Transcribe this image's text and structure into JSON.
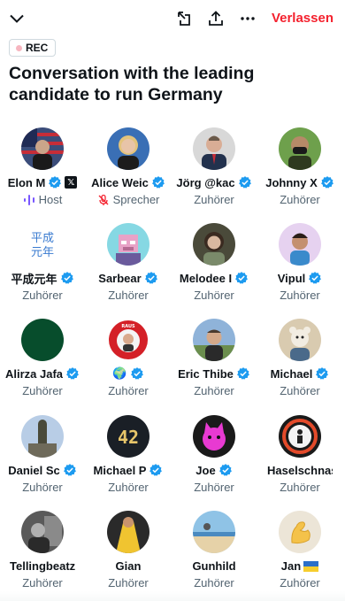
{
  "header": {
    "leave_label": "Verlassen",
    "icons": [
      "chevron-down-icon",
      "minimize-icon",
      "share-icon",
      "more-icon"
    ]
  },
  "rec_badge": "REC",
  "title": "Conversation with the leading candidate to run Germany",
  "accent": "#1d9bf0",
  "leave_color": "#f4212e",
  "participants": [
    {
      "name": "Elon M",
      "role": "Host",
      "verified": true,
      "avatar": "photo-man-flag"
    },
    {
      "name": "Alice Weic",
      "role": "Sprecher",
      "verified": true,
      "avatar": "photo-woman-blonde"
    },
    {
      "name": "Jörg @kac",
      "role": "Zuhörer",
      "verified": true,
      "avatar": "photo-man-suit"
    },
    {
      "name": "Johnny X",
      "role": "Zuhörer",
      "verified": true,
      "avatar": "photo-man-mask"
    },
    {
      "name": "平成元年",
      "role": "Zuhörer",
      "verified": true,
      "avatar": "kanji-logo",
      "avatar_text": [
        "平成",
        "元年"
      ]
    },
    {
      "name": "Sarbear",
      "role": "Zuhörer",
      "verified": true,
      "avatar": "pixel-ape"
    },
    {
      "name": "Melodee I",
      "role": "Zuhörer",
      "verified": true,
      "avatar": "photo-woman-dark"
    },
    {
      "name": "Vipul",
      "role": "Zuhörer",
      "verified": true,
      "avatar": "cartoon-man"
    },
    {
      "name": "Alirza Jafa",
      "role": "Zuhörer",
      "verified": true,
      "avatar": "green-circle"
    },
    {
      "name": "🌍",
      "role": "Zuhörer",
      "verified": true,
      "avatar": "sticker-red"
    },
    {
      "name": "Eric Thibe",
      "role": "Zuhörer",
      "verified": true,
      "avatar": "photo-man-outdoor"
    },
    {
      "name": "Michael",
      "role": "Zuhörer",
      "verified": true,
      "avatar": "cartoon-bear"
    },
    {
      "name": "Daniel Sc",
      "role": "Zuhörer",
      "verified": true,
      "avatar": "photo-statue"
    },
    {
      "name": "Michael P",
      "role": "Zuhörer",
      "verified": true,
      "avatar": "number-42",
      "avatar_text": [
        "42"
      ]
    },
    {
      "name": "Joe",
      "role": "Zuhörer",
      "verified": true,
      "avatar": "pink-cat"
    },
    {
      "name": "Haselschnas",
      "role": "Zuhörer",
      "verified": false,
      "avatar": "ring-figure"
    },
    {
      "name": "Tellingbeatz",
      "role": "Zuhörer",
      "verified": false,
      "avatar": "photo-bw"
    },
    {
      "name": "Gian",
      "role": "Zuhörer",
      "verified": false,
      "avatar": "photo-yellow"
    },
    {
      "name": "Gunhild",
      "role": "Zuhörer",
      "verified": false,
      "avatar": "photo-beach"
    },
    {
      "name": "Jan",
      "role": "Zuhörer",
      "verified": false,
      "avatar": "muscle-emoji",
      "flag": "ukraine"
    }
  ]
}
